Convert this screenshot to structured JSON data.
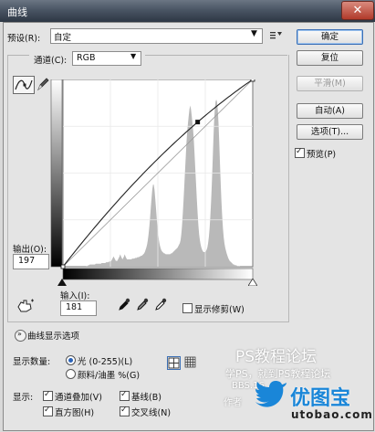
{
  "window": {
    "title": "曲线",
    "close": "✕"
  },
  "preset": {
    "label": "预设(R):",
    "value": "自定"
  },
  "channel": {
    "label": "通道(C):",
    "value": "RGB"
  },
  "buttons": {
    "ok": "确定",
    "reset": "复位",
    "smooth": "平滑(M)",
    "auto": "自动(A)",
    "options": "选项(T)..."
  },
  "preview": {
    "label": "预览(P)",
    "checked": true
  },
  "output": {
    "label": "输出(O):",
    "value": "197"
  },
  "input": {
    "label": "输入(I):",
    "value": "181"
  },
  "clipping": {
    "label": "显示修剪(W)",
    "checked": false
  },
  "display_options": {
    "label": "曲线显示选项"
  },
  "show_amount": {
    "label": "显示数量:",
    "options": [
      {
        "label": "光 (0-255)(L)",
        "checked": true
      },
      {
        "label": "颜料/油墨 %(G)",
        "checked": false
      }
    ]
  },
  "show": {
    "label": "显示:",
    "items": [
      {
        "label": "通道叠加(V)",
        "checked": true
      },
      {
        "label": "基线(B)",
        "checked": true
      },
      {
        "label": "直方图(H)",
        "checked": true
      },
      {
        "label": "交叉线(N)",
        "checked": true
      }
    ]
  },
  "watermarks": {
    "line1": "PS教程论坛",
    "line2": "学PS，就到PS教程论坛",
    "line3": "BBS.16",
    "line4": "作者",
    "brand_cn": "优图宝",
    "brand_url": "utobao.com"
  },
  "curve": {
    "input": 181,
    "output": 197
  },
  "histogram": [
    0,
    0,
    0,
    0,
    0,
    0,
    0,
    0,
    0,
    0,
    0,
    0,
    0,
    0,
    0,
    0,
    0,
    0,
    0,
    0,
    0,
    0,
    0,
    0,
    0,
    0,
    0,
    0,
    0,
    0,
    0,
    0,
    1,
    1,
    2,
    2,
    3,
    3,
    3,
    3,
    3,
    3,
    3,
    3,
    4,
    4,
    4,
    4,
    4,
    4,
    4,
    4,
    5,
    5,
    5,
    5,
    5,
    5,
    6,
    6,
    6,
    6,
    7,
    7,
    7,
    8,
    10,
    12,
    14,
    12,
    10,
    8,
    8,
    8,
    10,
    12,
    14,
    17,
    14,
    12,
    10,
    12,
    14,
    17,
    14,
    12,
    10,
    10,
    10,
    10,
    10,
    10,
    10,
    11,
    11,
    11,
    11,
    12,
    12,
    12,
    13,
    13,
    13,
    14,
    14,
    15,
    15,
    16,
    17,
    18,
    20,
    23,
    26,
    30,
    36,
    44,
    54,
    66,
    80,
    93,
    105,
    112,
    112,
    105,
    93,
    80,
    66,
    54,
    44,
    36,
    30,
    26,
    23,
    21,
    20,
    19,
    18,
    18,
    17,
    17,
    17,
    17,
    17,
    17,
    17,
    18,
    18,
    19,
    20,
    21,
    22,
    23,
    24,
    25,
    26,
    28,
    30,
    32,
    36,
    44,
    56,
    72,
    90,
    110,
    130,
    150,
    170,
    185,
    196,
    206,
    215,
    220,
    215,
    206,
    196,
    185,
    170,
    150,
    130,
    110,
    90,
    72,
    56,
    44,
    36,
    30,
    26,
    23,
    21,
    20,
    20,
    20,
    21,
    23,
    26,
    32,
    40,
    52,
    68,
    88,
    112,
    140,
    170,
    196,
    215,
    225,
    228,
    225,
    215,
    196,
    170,
    140,
    112,
    88,
    68,
    52,
    40,
    32,
    26,
    22,
    18,
    15,
    12,
    10,
    8,
    7,
    6,
    5,
    4,
    3,
    3,
    2,
    2,
    2,
    1,
    1,
    1,
    1,
    0,
    0,
    0,
    0,
    0,
    0,
    0,
    0,
    0,
    0,
    0,
    0,
    0,
    0,
    0,
    0,
    0,
    0,
    0,
    0,
    0,
    0,
    0,
    0,
    0
  ]
}
